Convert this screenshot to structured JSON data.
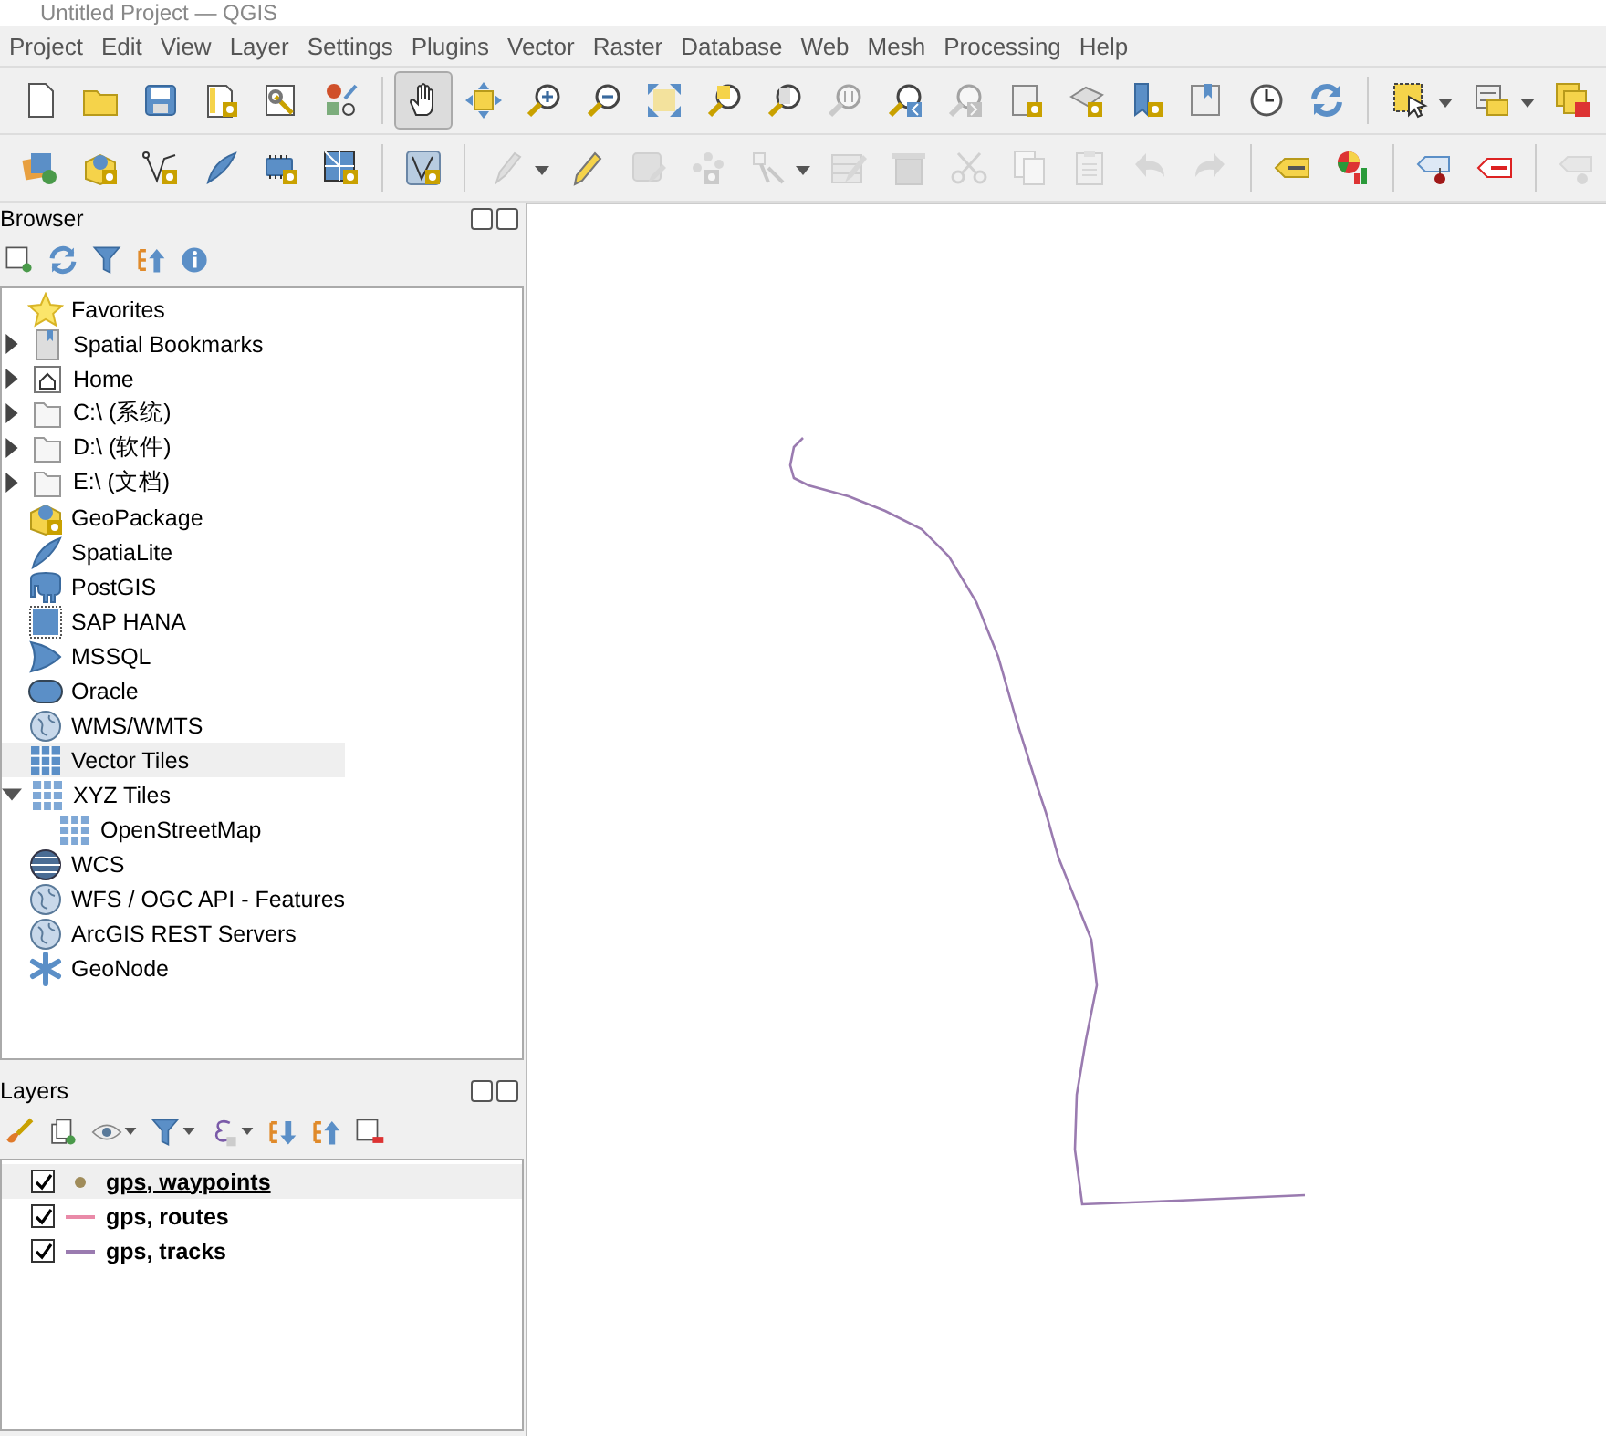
{
  "window": {
    "title": "Untitled Project — QGIS"
  },
  "menu": [
    "Project",
    "Edit",
    "View",
    "Layer",
    "Settings",
    "Plugins",
    "Vector",
    "Raster",
    "Database",
    "Web",
    "Mesh",
    "Processing",
    "Help"
  ],
  "toolbars": [
    {
      "items": [
        {
          "kind": "button",
          "disabled": false,
          "selected": false,
          "dropdown": false
        },
        {
          "kind": "button",
          "disabled": false,
          "selected": false,
          "dropdown": false
        },
        {
          "kind": "button",
          "disabled": false,
          "selected": false,
          "dropdown": false
        },
        {
          "kind": "button",
          "disabled": false,
          "selected": false,
          "dropdown": false
        },
        {
          "kind": "button",
          "disabled": false,
          "selected": false,
          "dropdown": false
        },
        {
          "kind": "button",
          "disabled": false,
          "selected": false,
          "dropdown": false
        },
        {
          "kind": "separator"
        },
        {
          "kind": "button",
          "disabled": false,
          "selected": true,
          "dropdown": false
        },
        {
          "kind": "button",
          "disabled": false,
          "selected": false,
          "dropdown": false
        },
        {
          "kind": "button",
          "disabled": false,
          "selected": false,
          "dropdown": false
        },
        {
          "kind": "button",
          "disabled": false,
          "selected": false,
          "dropdown": false
        },
        {
          "kind": "button",
          "disabled": false,
          "selected": false,
          "dropdown": false
        },
        {
          "kind": "button",
          "disabled": false,
          "selected": false,
          "dropdown": false
        },
        {
          "kind": "button",
          "disabled": false,
          "selected": false,
          "dropdown": false
        },
        {
          "kind": "button",
          "disabled": true,
          "selected": false,
          "dropdown": false
        },
        {
          "kind": "button",
          "disabled": false,
          "selected": false,
          "dropdown": false
        },
        {
          "kind": "button",
          "disabled": true,
          "selected": false,
          "dropdown": false
        },
        {
          "kind": "button",
          "disabled": false,
          "selected": false,
          "dropdown": false
        },
        {
          "kind": "button",
          "disabled": false,
          "selected": false,
          "dropdown": false
        },
        {
          "kind": "button",
          "disabled": false,
          "selected": false,
          "dropdown": false
        },
        {
          "kind": "button",
          "disabled": false,
          "selected": false,
          "dropdown": false
        },
        {
          "kind": "button",
          "disabled": false,
          "selected": false,
          "dropdown": false
        },
        {
          "kind": "button",
          "disabled": false,
          "selected": false,
          "dropdown": false
        },
        {
          "kind": "separator"
        },
        {
          "kind": "button",
          "disabled": false,
          "selected": false,
          "dropdown": true
        },
        {
          "kind": "button",
          "disabled": false,
          "selected": false,
          "dropdown": true
        },
        {
          "kind": "button",
          "disabled": false,
          "selected": false,
          "dropdown": false
        }
      ]
    },
    {
      "items": [
        {
          "kind": "button",
          "disabled": false,
          "selected": false,
          "dropdown": false
        },
        {
          "kind": "button",
          "disabled": false,
          "selected": false,
          "dropdown": false
        },
        {
          "kind": "button",
          "disabled": false,
          "selected": false,
          "dropdown": false
        },
        {
          "kind": "button",
          "disabled": false,
          "selected": false,
          "dropdown": false
        },
        {
          "kind": "button",
          "disabled": false,
          "selected": false,
          "dropdown": false
        },
        {
          "kind": "button",
          "disabled": false,
          "selected": false,
          "dropdown": false
        },
        {
          "kind": "separator"
        },
        {
          "kind": "button",
          "disabled": false,
          "selected": false,
          "dropdown": false
        },
        {
          "kind": "separator"
        },
        {
          "kind": "button",
          "disabled": true,
          "selected": false,
          "dropdown": true
        },
        {
          "kind": "button",
          "disabled": false,
          "selected": false,
          "dropdown": false
        },
        {
          "kind": "button",
          "disabled": true,
          "selected": false,
          "dropdown": false
        },
        {
          "kind": "button",
          "disabled": true,
          "selected": false,
          "dropdown": false
        },
        {
          "kind": "button",
          "disabled": true,
          "selected": false,
          "dropdown": true
        },
        {
          "kind": "button",
          "disabled": true,
          "selected": false,
          "dropdown": false
        },
        {
          "kind": "button",
          "disabled": true,
          "selected": false,
          "dropdown": false
        },
        {
          "kind": "button",
          "disabled": true,
          "selected": false,
          "dropdown": false
        },
        {
          "kind": "button",
          "disabled": true,
          "selected": false,
          "dropdown": false
        },
        {
          "kind": "button",
          "disabled": true,
          "selected": false,
          "dropdown": false
        },
        {
          "kind": "button",
          "disabled": true,
          "selected": false,
          "dropdown": false
        },
        {
          "kind": "button",
          "disabled": true,
          "selected": false,
          "dropdown": false
        },
        {
          "kind": "separator"
        },
        {
          "kind": "button",
          "disabled": false,
          "selected": false,
          "dropdown": false
        },
        {
          "kind": "button",
          "disabled": false,
          "selected": false,
          "dropdown": false
        },
        {
          "kind": "separator"
        },
        {
          "kind": "button",
          "disabled": false,
          "selected": false,
          "dropdown": false
        },
        {
          "kind": "button",
          "disabled": false,
          "selected": false,
          "dropdown": false
        },
        {
          "kind": "separator"
        },
        {
          "kind": "button",
          "disabled": true,
          "selected": false,
          "dropdown": false
        }
      ]
    }
  ],
  "browser": {
    "title": "Browser",
    "items": [
      {
        "label": "Favorites",
        "selected": false
      },
      {
        "label": "Spatial Bookmarks",
        "expanded": false,
        "selected": false
      },
      {
        "label": "Home",
        "expanded": false,
        "selected": false
      },
      {
        "label": "C:\\ (系统)",
        "expanded": false,
        "selected": false
      },
      {
        "label": "D:\\ (软件)",
        "expanded": false,
        "selected": false
      },
      {
        "label": "E:\\ (文档)",
        "expanded": false,
        "selected": false
      },
      {
        "label": "GeoPackage",
        "selected": false
      },
      {
        "label": "SpatiaLite",
        "selected": false
      },
      {
        "label": "PostGIS",
        "selected": false
      },
      {
        "label": "SAP HANA",
        "selected": false
      },
      {
        "label": "MSSQL",
        "selected": false
      },
      {
        "label": "Oracle",
        "selected": false
      },
      {
        "label": "WMS/WMTS",
        "selected": false
      },
      {
        "label": "Vector Tiles",
        "selected": true
      },
      {
        "label": "XYZ Tiles",
        "expanded": true,
        "selected": false,
        "children": [
          {
            "label": "OpenStreetMap",
            "selected": false
          }
        ]
      },
      {
        "label": "WCS",
        "selected": false
      },
      {
        "label": "WFS / OGC API - Features",
        "selected": false
      },
      {
        "label": "ArcGIS REST Servers",
        "selected": false
      },
      {
        "label": "GeoNode",
        "selected": false
      }
    ]
  },
  "layers": {
    "title": "Layers",
    "items": [
      {
        "name": "gps, waypoints",
        "checked": true,
        "selected": true,
        "kind": "point",
        "color": "#a08c5a"
      },
      {
        "name": "gps, routes",
        "checked": true,
        "selected": false,
        "kind": "line",
        "color": "#e98aa8"
      },
      {
        "name": "gps, tracks",
        "checked": true,
        "selected": false,
        "kind": "line",
        "color": "#9a7bb0"
      }
    ]
  }
}
